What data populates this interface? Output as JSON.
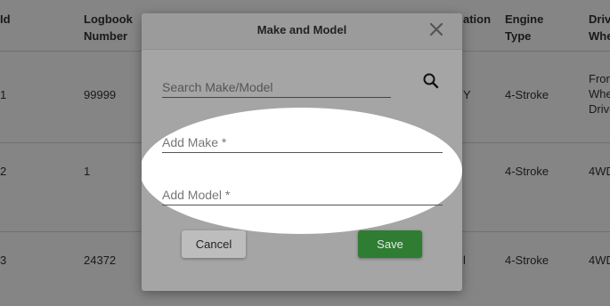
{
  "table": {
    "headers": {
      "col1": "Id",
      "logbook": "Logbook Number",
      "location": "ation",
      "engine": "Engine Type",
      "drive": "Drive Whe"
    },
    "rows": [
      {
        "id": "1",
        "logbook": "99999",
        "location": "Y",
        "engine": "4-Stroke",
        "drive": "Fron Whe Drive"
      },
      {
        "id": "2",
        "logbook": "1",
        "location": "",
        "engine": "4-Stroke",
        "drive": "4WD"
      },
      {
        "id": "3",
        "logbook": "24372",
        "location": "l",
        "engine": "4-Stroke",
        "drive": "4WD"
      }
    ]
  },
  "dialog": {
    "title": "Make and Model",
    "close_icon": "close-icon",
    "search": {
      "placeholder": "Search Make/Model",
      "value": "",
      "icon": "search-icon"
    },
    "make": {
      "placeholder": "Add Make *",
      "value": ""
    },
    "model": {
      "placeholder": "Add Model *",
      "value": ""
    },
    "cancel_label": "Cancel",
    "save_label": "Save",
    "save_color": "#2e7d32"
  }
}
